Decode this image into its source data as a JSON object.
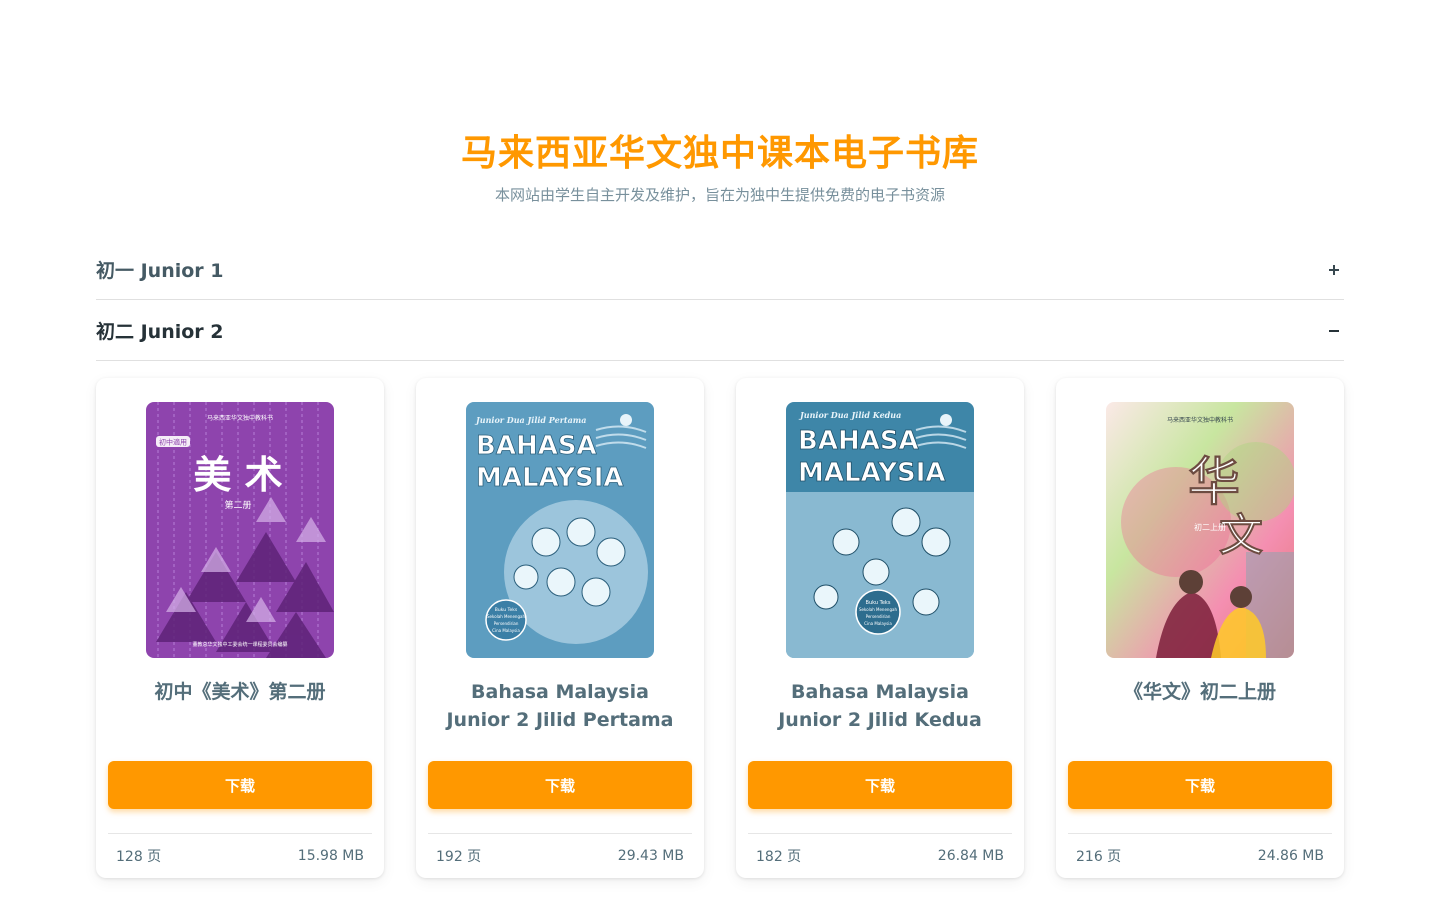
{
  "header": {
    "title": "马来西亚华文独中课本电子书库",
    "subtitle": "本网站由学生自主开发及维护，旨在为独中生提供免费的电子书资源"
  },
  "sections": [
    {
      "label": "初一 Junior 1",
      "toggle": "+",
      "expanded": false
    },
    {
      "label": "初二 Junior 2",
      "toggle": "−",
      "expanded": true
    }
  ],
  "books": [
    {
      "title_lines": [
        "初中《美术》第二册"
      ],
      "download_label": "下载",
      "pages": "128 页",
      "size": "15.98 MB",
      "cover": {
        "top_text": "马来西亚华文独中教科书",
        "badge": "初中適用",
        "title": "美 术",
        "volume": "第二册",
        "bottom_text": "董教总华文独中工委会统一课程委员会编纂"
      }
    },
    {
      "title_lines": [
        "Bahasa Malaysia",
        "Junior 2 Jilid Pertama"
      ],
      "download_label": "下载",
      "pages": "192 页",
      "size": "29.43 MB",
      "cover": {
        "top_text": "Junior Dua Jilid Pertama",
        "line1": "BAHASA",
        "line2": "MALAYSIA",
        "seal_lines": [
          "Buku Teks",
          "Sekolah Menengah",
          "Persendirian",
          "Cina Malaysia"
        ]
      }
    },
    {
      "title_lines": [
        "Bahasa Malaysia",
        "Junior 2 Jilid Kedua"
      ],
      "download_label": "下载",
      "pages": "182 页",
      "size": "26.84 MB",
      "cover": {
        "top_text": "Junior Dua Jilid Kedua",
        "line1": "BAHASA",
        "line2": "MALAYSIA",
        "seal_lines": [
          "Buku Teks",
          "Sekolah Menengah",
          "Persendirian",
          "Cina Malaysia"
        ]
      }
    },
    {
      "title_lines": [
        "《华文》初二上册"
      ],
      "download_label": "下载",
      "pages": "216 页",
      "size": "24.86 MB",
      "cover": {
        "top_text": "马来西亚华文独中教科书",
        "title_a": "华",
        "title_b": "文",
        "volume": "初二上册"
      }
    }
  ],
  "colors": {
    "accent": "#ff9800",
    "subtitle": "#78909c",
    "text": "#546e7a",
    "art_cover": "#8e44ad",
    "bm_cover": "#4a8fb0",
    "hw_cover": "#f2a7a7"
  }
}
